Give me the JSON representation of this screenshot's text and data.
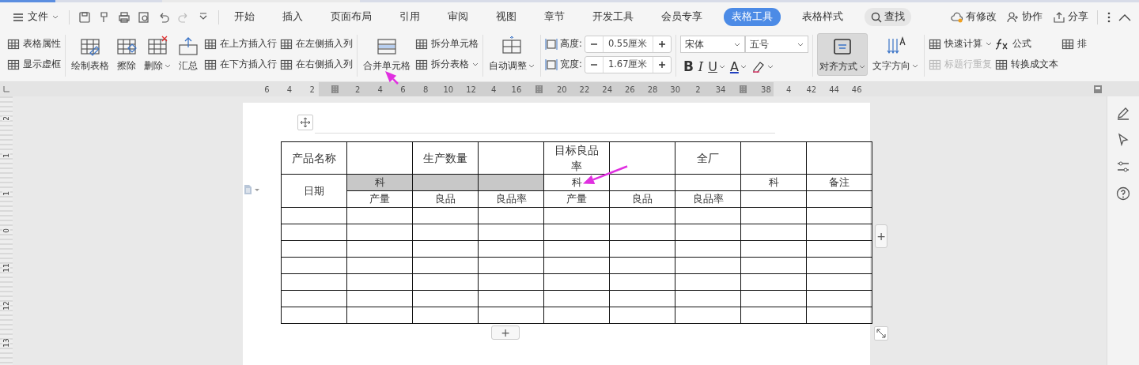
{
  "menu_bar": {
    "file_menu": "文件",
    "tabs": [
      {
        "label": "开始",
        "selected": false
      },
      {
        "label": "插入",
        "selected": false
      },
      {
        "label": "页面布局",
        "selected": false
      },
      {
        "label": "引用",
        "selected": false
      },
      {
        "label": "审阅",
        "selected": false
      },
      {
        "label": "视图",
        "selected": false
      },
      {
        "label": "章节",
        "selected": false
      },
      {
        "label": "开发工具",
        "selected": false
      },
      {
        "label": "会员专享",
        "selected": false
      },
      {
        "label": "表格工具",
        "selected": true
      },
      {
        "label": "表格样式",
        "selected": false
      }
    ],
    "search": "查找",
    "actions": [
      "有修改",
      "协作",
      "分享"
    ]
  },
  "ribbon": {
    "groups": [
      {
        "items": [
          {
            "kind": "small",
            "label": "表格属性"
          },
          {
            "kind": "small",
            "label": "显示虚框"
          }
        ]
      },
      {
        "items": [
          {
            "kind": "big",
            "label": "绘制表格"
          },
          {
            "kind": "big",
            "label": "擦除"
          },
          {
            "kind": "big",
            "label": "删除",
            "dropdown": true
          },
          {
            "kind": "big",
            "label": "汇总"
          },
          {
            "kind": "small",
            "label": "在上方插入行"
          },
          {
            "kind": "small",
            "label": "在下方插入行"
          },
          {
            "kind": "small",
            "label": "在左侧插入列"
          },
          {
            "kind": "small",
            "label": "在右侧插入列"
          }
        ]
      },
      {
        "items": [
          {
            "kind": "big",
            "label": "合并单元格",
            "arrow": true
          },
          {
            "kind": "small",
            "label": "拆分单元格"
          },
          {
            "kind": "small",
            "label": "拆分表格",
            "dropdown": true
          }
        ]
      },
      {
        "items": [
          {
            "kind": "big",
            "label": "自动调整",
            "dropdown": true
          }
        ]
      },
      {
        "items": [
          {
            "kind": "stepper",
            "label": "高度:",
            "value": "0.55厘米"
          },
          {
            "kind": "stepper",
            "label": "宽度:",
            "value": "1.67厘米"
          }
        ]
      },
      {
        "items": [
          {
            "kind": "select",
            "value": "宋体"
          },
          {
            "kind": "select",
            "value": "五号"
          },
          {
            "kind": "format",
            "label": "B"
          },
          {
            "kind": "format",
            "label": "I"
          },
          {
            "kind": "format",
            "label": "U",
            "dropdown": true
          },
          {
            "kind": "format",
            "label": "A",
            "dropdown": true
          },
          {
            "kind": "format",
            "dropdown": true
          }
        ]
      },
      {
        "items": [
          {
            "kind": "big",
            "label": "对齐方式",
            "dropdown": true,
            "pressed": true
          },
          {
            "kind": "big",
            "label": "文字方向",
            "dropdown": true
          }
        ]
      },
      {
        "items": [
          {
            "kind": "small",
            "label": "快速计算",
            "dropdown": true
          },
          {
            "kind": "small",
            "label": "标题行重复",
            "disabled": true
          },
          {
            "kind": "small",
            "label": "公式"
          },
          {
            "kind": "small",
            "label": "转换成文本"
          },
          {
            "kind": "small",
            "label": "排"
          }
        ]
      }
    ]
  },
  "ruler": {
    "labels": [
      {
        "kind": "number",
        "text": "6"
      },
      {
        "kind": "number",
        "text": "4"
      },
      {
        "kind": "number",
        "text": "2"
      },
      {
        "kind": "marker"
      },
      {
        "kind": "number",
        "text": "2"
      },
      {
        "kind": "number",
        "text": "4"
      },
      {
        "kind": "number",
        "text": "6"
      },
      {
        "kind": "number",
        "text": "8"
      },
      {
        "kind": "number",
        "text": "10"
      },
      {
        "kind": "number",
        "text": "12"
      },
      {
        "kind": "number",
        "text": "4"
      },
      {
        "kind": "number",
        "text": "16"
      },
      {
        "kind": "marker"
      },
      {
        "kind": "number",
        "text": "20"
      },
      {
        "kind": "number",
        "text": "22"
      },
      {
        "kind": "number",
        "text": "24"
      },
      {
        "kind": "number",
        "text": "26"
      },
      {
        "kind": "number",
        "text": "28"
      },
      {
        "kind": "number",
        "text": "30"
      },
      {
        "kind": "number",
        "text": "2"
      },
      {
        "kind": "number",
        "text": "34"
      },
      {
        "kind": "marker"
      },
      {
        "kind": "number",
        "text": "38"
      },
      {
        "kind": "number",
        "text": "4"
      },
      {
        "kind": "number",
        "text": "42"
      },
      {
        "kind": "number",
        "text": "44"
      },
      {
        "kind": "number",
        "text": "46"
      }
    ]
  },
  "vertical_ruler": {
    "labels": [
      "2",
      "1",
      "1",
      "0",
      "11",
      "12",
      "13"
    ]
  },
  "table": {
    "rows": [
      {
        "cells": [
          {
            "text": "产品名称",
            "selected": false
          },
          {
            "selected": false
          },
          {
            "text": "生产数量",
            "selected": false
          },
          {
            "selected": false
          },
          {
            "text": "目标良品率",
            "selected": false
          },
          {
            "selected": false
          },
          {
            "text": "全厂",
            "selected": false
          },
          {
            "selected": false
          },
          {
            "selected": false
          }
        ]
      },
      {
        "cells": [
          {
            "text": "日期",
            "selected": false,
            "rowspan": 2
          },
          {
            "text": "科",
            "selected": true
          },
          {
            "selected": true
          },
          {
            "selected": true
          },
          {
            "text": "科",
            "selected": false,
            "arrow": true
          },
          {
            "selected": false
          },
          {
            "selected": false
          },
          {
            "text": "科",
            "selected": false
          },
          {
            "text": "备注",
            "selected": false
          }
        ]
      },
      {
        "cells": [
          {
            "text": "产量",
            "selected": false
          },
          {
            "text": "良品",
            "selected": false
          },
          {
            "text": "良品率",
            "selected": false
          },
          {
            "text": "产量",
            "selected": false
          },
          {
            "text": "良品",
            "selected": false
          },
          {
            "text": "良品率",
            "selected": false
          },
          {
            "selected": false
          },
          {
            "selected": false
          }
        ]
      },
      {
        "cells": [
          {
            "selected": false
          },
          {
            "selected": false
          },
          {
            "selected": false
          },
          {
            "selected": false
          },
          {
            "selected": false
          },
          {
            "selected": false
          },
          {
            "selected": false
          },
          {
            "selected": false
          },
          {
            "selected": false
          }
        ]
      },
      {
        "cells": [
          {
            "selected": false
          },
          {
            "selected": false
          },
          {
            "selected": false
          },
          {
            "selected": false
          },
          {
            "selected": false
          },
          {
            "selected": false
          },
          {
            "selected": false
          },
          {
            "selected": false
          },
          {
            "selected": false
          }
        ]
      },
      {
        "cells": [
          {
            "selected": false
          },
          {
            "selected": false
          },
          {
            "selected": false
          },
          {
            "selected": false
          },
          {
            "selected": false
          },
          {
            "selected": false
          },
          {
            "selected": false
          },
          {
            "selected": false
          },
          {
            "selected": false
          }
        ]
      },
      {
        "cells": [
          {
            "selected": false
          },
          {
            "selected": false
          },
          {
            "selected": false
          },
          {
            "selected": false
          },
          {
            "selected": false
          },
          {
            "selected": false
          },
          {
            "selected": false
          },
          {
            "selected": false
          },
          {
            "selected": false
          }
        ]
      },
      {
        "cells": [
          {
            "selected": false
          },
          {
            "selected": false
          },
          {
            "selected": false
          },
          {
            "selected": false
          },
          {
            "selected": false
          },
          {
            "selected": false
          },
          {
            "selected": false
          },
          {
            "selected": false
          },
          {
            "selected": false
          }
        ]
      },
      {
        "cells": [
          {
            "selected": false
          },
          {
            "selected": false
          },
          {
            "selected": false
          },
          {
            "selected": false
          },
          {
            "selected": false
          },
          {
            "selected": false
          },
          {
            "selected": false
          },
          {
            "selected": false
          },
          {
            "selected": false
          }
        ]
      },
      {
        "cells": [
          {
            "selected": false
          },
          {
            "selected": false
          },
          {
            "selected": false
          },
          {
            "selected": false
          },
          {
            "selected": false
          },
          {
            "selected": false
          },
          {
            "selected": false
          },
          {
            "selected": false
          },
          {
            "selected": false
          }
        ]
      }
    ],
    "add_column": "+",
    "add_row": "+"
  }
}
